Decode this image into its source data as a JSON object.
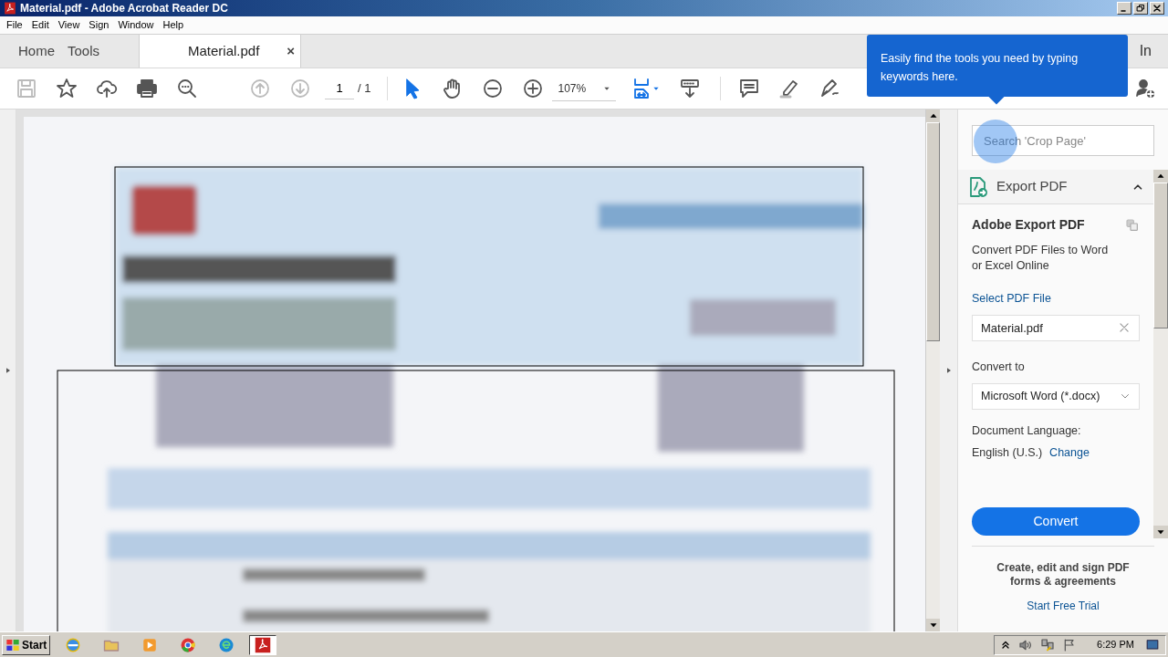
{
  "window": {
    "title": "Material.pdf - Adobe Acrobat Reader DC"
  },
  "menu": [
    "File",
    "Edit",
    "View",
    "Sign",
    "Window",
    "Help"
  ],
  "tabs": [
    {
      "label": "Home",
      "selected": false,
      "closable": false
    },
    {
      "label": "Tools",
      "selected": false,
      "closable": false
    },
    {
      "label": "Material.pdf",
      "selected": true,
      "closable": true
    }
  ],
  "close_tab": "×",
  "sign_in": "In",
  "toolbar": {
    "page_number": "1",
    "page_total": "/ 1",
    "zoom": "107%"
  },
  "tooltip": "Easily find the tools you need by typing keywords here.",
  "panel": {
    "search_placeholder": "Search 'Crop Page'",
    "section": {
      "title": "Export PDF",
      "expanded": true
    },
    "heading": "Adobe Export PDF",
    "description": "Convert PDF Files to Word or Excel Online",
    "select_label": "Select PDF File",
    "file": "Material.pdf",
    "convert_to_label": "Convert to",
    "format": "Microsoft Word (*.docx)",
    "language_label": "Document Language:",
    "language": "English (U.S.)",
    "change_link": "Change",
    "convert_button": "Convert",
    "promo": "Create, edit and sign PDF forms & agreements",
    "trial_link": "Start Free Trial"
  },
  "taskbar": {
    "start": "Start",
    "clock": "6:29 PM"
  }
}
